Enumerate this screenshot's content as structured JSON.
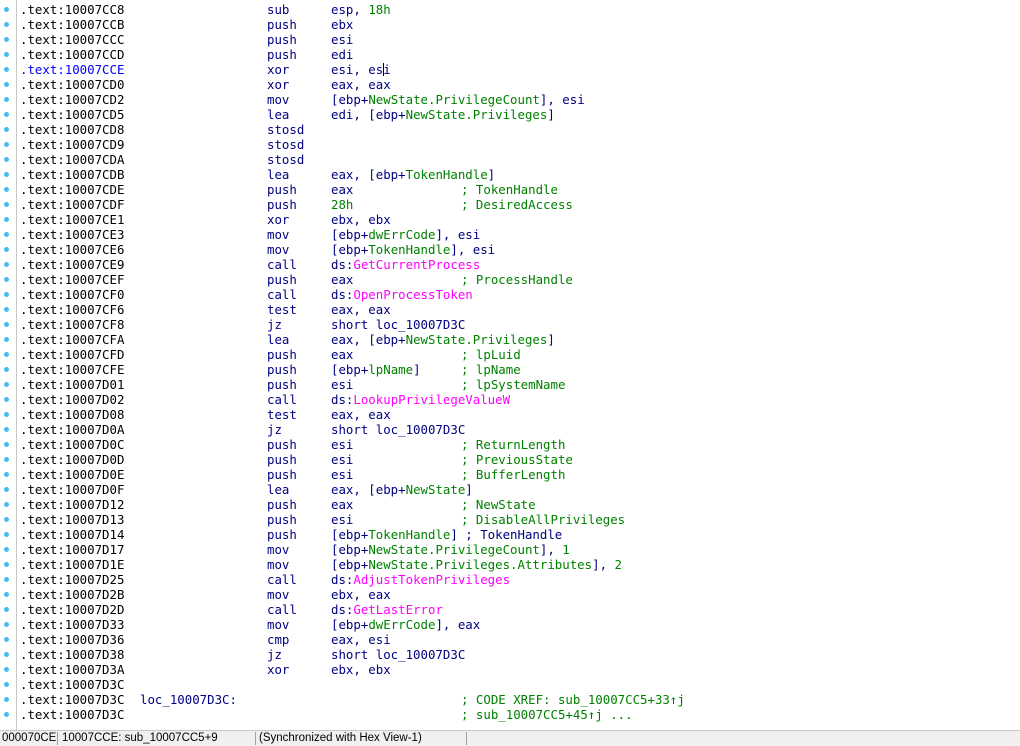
{
  "listing": {
    "current_address_index": 4,
    "rows": [
      {
        "addr": ".text:10007CC8",
        "mn": "sub",
        "op": [
          {
            "t": "esp, "
          },
          {
            "t": "18h",
            "c": "num"
          }
        ]
      },
      {
        "addr": ".text:10007CCB",
        "mn": "push",
        "op": [
          {
            "t": "ebx"
          }
        ]
      },
      {
        "addr": ".text:10007CCC",
        "mn": "push",
        "op": [
          {
            "t": "esi"
          }
        ]
      },
      {
        "addr": ".text:10007CCD",
        "mn": "push",
        "op": [
          {
            "t": "edi"
          }
        ]
      },
      {
        "addr": ".text:10007CCE",
        "mn": "xor",
        "op": [
          {
            "t": "esi, esi"
          }
        ]
      },
      {
        "addr": ".text:10007CD0",
        "mn": "xor",
        "op": [
          {
            "t": "eax, eax"
          }
        ]
      },
      {
        "addr": ".text:10007CD2",
        "mn": "mov",
        "op": [
          {
            "t": "[ebp+"
          },
          {
            "t": "NewState.PrivilegeCount",
            "c": "var"
          },
          {
            "t": "], esi"
          }
        ]
      },
      {
        "addr": ".text:10007CD5",
        "mn": "lea",
        "op": [
          {
            "t": "edi, [ebp+"
          },
          {
            "t": "NewState.Privileges",
            "c": "var"
          },
          {
            "t": "]"
          }
        ]
      },
      {
        "addr": ".text:10007CD8",
        "mn": "stosd",
        "op": []
      },
      {
        "addr": ".text:10007CD9",
        "mn": "stosd",
        "op": []
      },
      {
        "addr": ".text:10007CDA",
        "mn": "stosd",
        "op": []
      },
      {
        "addr": ".text:10007CDB",
        "mn": "lea",
        "op": [
          {
            "t": "eax, [ebp+"
          },
          {
            "t": "TokenHandle",
            "c": "var"
          },
          {
            "t": "]"
          }
        ]
      },
      {
        "addr": ".text:10007CDE",
        "mn": "push",
        "op": [
          {
            "t": "eax"
          }
        ],
        "cm": "; TokenHandle"
      },
      {
        "addr": ".text:10007CDF",
        "mn": "push",
        "op": [
          {
            "t": "28h",
            "c": "num"
          }
        ],
        "cm": "; DesiredAccess"
      },
      {
        "addr": ".text:10007CE1",
        "mn": "xor",
        "op": [
          {
            "t": "ebx, ebx"
          }
        ]
      },
      {
        "addr": ".text:10007CE3",
        "mn": "mov",
        "op": [
          {
            "t": "[ebp+"
          },
          {
            "t": "dwErrCode",
            "c": "var"
          },
          {
            "t": "], esi"
          }
        ]
      },
      {
        "addr": ".text:10007CE6",
        "mn": "mov",
        "op": [
          {
            "t": "[ebp+"
          },
          {
            "t": "TokenHandle",
            "c": "var"
          },
          {
            "t": "], esi"
          }
        ]
      },
      {
        "addr": ".text:10007CE9",
        "mn": "call",
        "op": [
          {
            "t": "ds:"
          },
          {
            "t": "GetCurrentProcess",
            "c": "fn"
          }
        ]
      },
      {
        "addr": ".text:10007CEF",
        "mn": "push",
        "op": [
          {
            "t": "eax"
          }
        ],
        "cm": "; ProcessHandle"
      },
      {
        "addr": ".text:10007CF0",
        "mn": "call",
        "op": [
          {
            "t": "ds:"
          },
          {
            "t": "OpenProcessToken",
            "c": "fn"
          }
        ]
      },
      {
        "addr": ".text:10007CF6",
        "mn": "test",
        "op": [
          {
            "t": "eax, eax"
          }
        ]
      },
      {
        "addr": ".text:10007CF8",
        "mn": "jz",
        "op": [
          {
            "t": "short loc_10007D3C"
          }
        ]
      },
      {
        "addr": ".text:10007CFA",
        "mn": "lea",
        "op": [
          {
            "t": "eax, [ebp+"
          },
          {
            "t": "NewState.Privileges",
            "c": "var"
          },
          {
            "t": "]"
          }
        ]
      },
      {
        "addr": ".text:10007CFD",
        "mn": "push",
        "op": [
          {
            "t": "eax"
          }
        ],
        "cm": "; lpLuid"
      },
      {
        "addr": ".text:10007CFE",
        "mn": "push",
        "op": [
          {
            "t": "[ebp+"
          },
          {
            "t": "lpName",
            "c": "var"
          },
          {
            "t": "]"
          }
        ],
        "cm": "; lpName"
      },
      {
        "addr": ".text:10007D01",
        "mn": "push",
        "op": [
          {
            "t": "esi"
          }
        ],
        "cm": "; lpSystemName"
      },
      {
        "addr": ".text:10007D02",
        "mn": "call",
        "op": [
          {
            "t": "ds:"
          },
          {
            "t": "LookupPrivilegeValueW",
            "c": "fn"
          }
        ]
      },
      {
        "addr": ".text:10007D08",
        "mn": "test",
        "op": [
          {
            "t": "eax, eax"
          }
        ]
      },
      {
        "addr": ".text:10007D0A",
        "mn": "jz",
        "op": [
          {
            "t": "short loc_10007D3C"
          }
        ]
      },
      {
        "addr": ".text:10007D0C",
        "mn": "push",
        "op": [
          {
            "t": "esi"
          }
        ],
        "cm": "; ReturnLength"
      },
      {
        "addr": ".text:10007D0D",
        "mn": "push",
        "op": [
          {
            "t": "esi"
          }
        ],
        "cm": "; PreviousState"
      },
      {
        "addr": ".text:10007D0E",
        "mn": "push",
        "op": [
          {
            "t": "esi"
          }
        ],
        "cm": "; BufferLength"
      },
      {
        "addr": ".text:10007D0F",
        "mn": "lea",
        "op": [
          {
            "t": "eax, [ebp+"
          },
          {
            "t": "NewState",
            "c": "var"
          },
          {
            "t": "]"
          }
        ]
      },
      {
        "addr": ".text:10007D12",
        "mn": "push",
        "op": [
          {
            "t": "eax"
          }
        ],
        "cm": "; NewState"
      },
      {
        "addr": ".text:10007D13",
        "mn": "push",
        "op": [
          {
            "t": "esi"
          }
        ],
        "cm": "; DisableAllPrivileges"
      },
      {
        "addr": ".text:10007D14",
        "mn": "push",
        "op": [
          {
            "t": "[ebp+"
          },
          {
            "t": "TokenHandle",
            "c": "var"
          },
          {
            "t": "] ; TokenHandle"
          }
        ]
      },
      {
        "addr": ".text:10007D17",
        "mn": "mov",
        "op": [
          {
            "t": "[ebp+"
          },
          {
            "t": "NewState.PrivilegeCount",
            "c": "var"
          },
          {
            "t": "], "
          },
          {
            "t": "1",
            "c": "num"
          }
        ]
      },
      {
        "addr": ".text:10007D1E",
        "mn": "mov",
        "op": [
          {
            "t": "[ebp+"
          },
          {
            "t": "NewState.Privileges.Attributes",
            "c": "var"
          },
          {
            "t": "], "
          },
          {
            "t": "2",
            "c": "num"
          }
        ]
      },
      {
        "addr": ".text:10007D25",
        "mn": "call",
        "op": [
          {
            "t": "ds:"
          },
          {
            "t": "AdjustTokenPrivileges",
            "c": "fn"
          }
        ]
      },
      {
        "addr": ".text:10007D2B",
        "mn": "mov",
        "op": [
          {
            "t": "ebx, eax"
          }
        ]
      },
      {
        "addr": ".text:10007D2D",
        "mn": "call",
        "op": [
          {
            "t": "ds:"
          },
          {
            "t": "GetLastError",
            "c": "fn"
          }
        ]
      },
      {
        "addr": ".text:10007D33",
        "mn": "mov",
        "op": [
          {
            "t": "[ebp+"
          },
          {
            "t": "dwErrCode",
            "c": "var"
          },
          {
            "t": "], eax"
          }
        ]
      },
      {
        "addr": ".text:10007D36",
        "mn": "cmp",
        "op": [
          {
            "t": "eax, esi"
          }
        ]
      },
      {
        "addr": ".text:10007D38",
        "mn": "jz",
        "op": [
          {
            "t": "short loc_10007D3C"
          }
        ]
      },
      {
        "addr": ".text:10007D3A",
        "mn": "xor",
        "op": [
          {
            "t": "ebx, ebx"
          }
        ]
      },
      {
        "addr": ".text:10007D3C",
        "mn": "",
        "op": []
      },
      {
        "addr": ".text:10007D3C",
        "label": "loc_10007D3C:",
        "mn": "",
        "op": [],
        "cm": "; CODE XREF: sub_10007CC5+33↑j"
      },
      {
        "addr": ".text:10007D3C",
        "mn": "",
        "op": [],
        "cm2": "; sub_10007CC5+45↑j ..."
      }
    ]
  },
  "statusbar": {
    "offset": "000070CE",
    "location": "10007CCE: sub_10007CC5+9",
    "sync": "(Synchronized with Hex View-1)"
  },
  "colors": {
    "text": "#000080",
    "variable": "#008000",
    "api_call": "#ff00ff",
    "current_address": "#0000ff",
    "gutter_dot": "#4ab8ef"
  }
}
